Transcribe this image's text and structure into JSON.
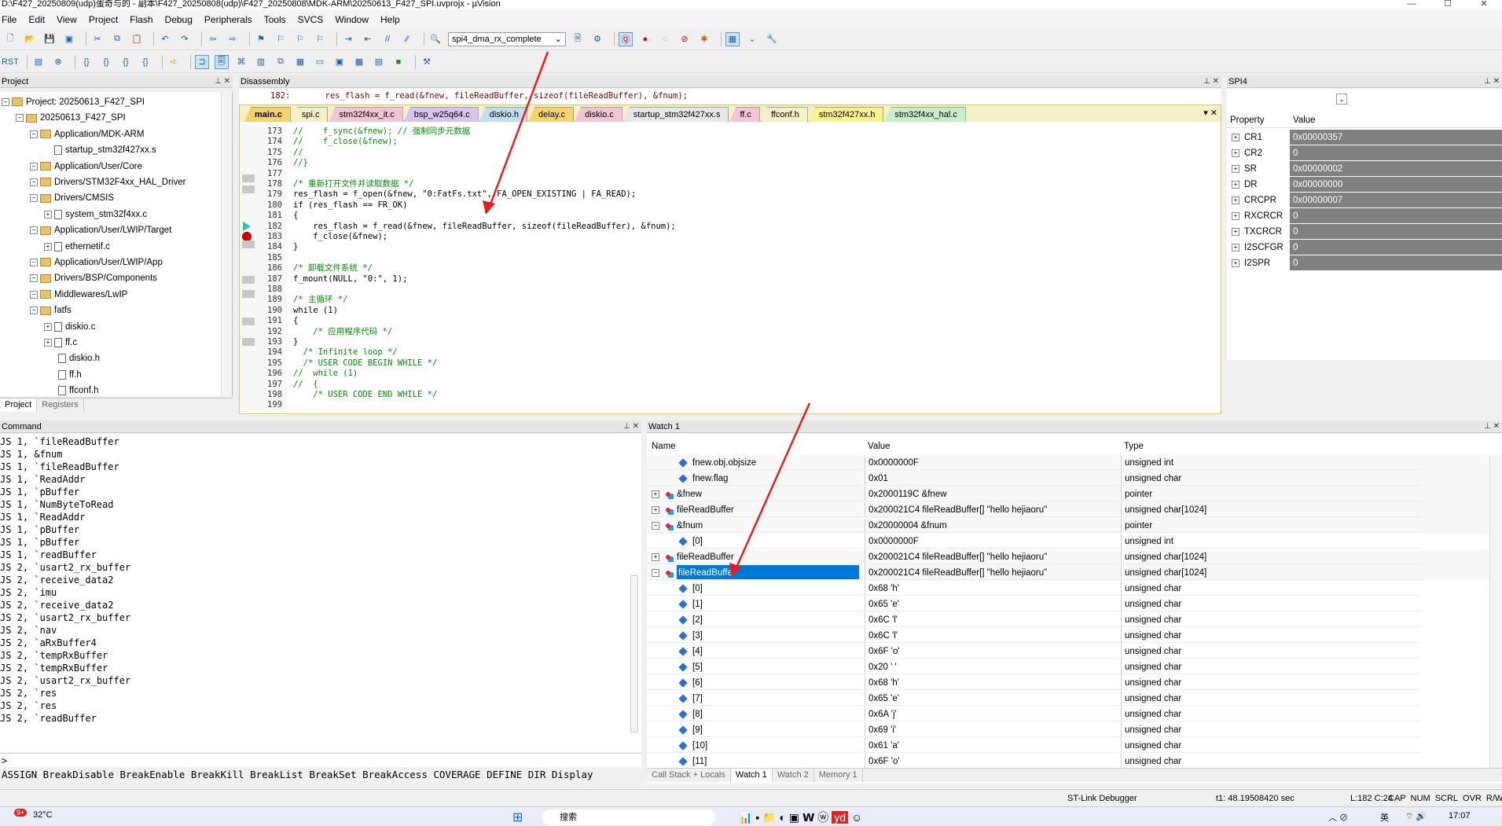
{
  "window": {
    "title": "D:\\F427_20250809(udp)蛋奇与的 - 副本\\F427_20250808(udp)\\F427_20250808\\MDK-ARM\\20250613_F427_SPI.uvprojx - µVision"
  },
  "menu": [
    "File",
    "Edit",
    "View",
    "Project",
    "Flash",
    "Debug",
    "Peripherals",
    "Tools",
    "SVCS",
    "Window",
    "Help"
  ],
  "toolbar": {
    "target": "spi4_dma_rx_complete"
  },
  "project": {
    "header": "Project",
    "items": [
      {
        "text": "Project: 20250613_F427_SPI",
        "indent": 0,
        "kind": "root"
      },
      {
        "text": "20250613_F427_SPI",
        "indent": 1,
        "kind": "folder"
      },
      {
        "text": "Application/MDK-ARM",
        "indent": 2,
        "kind": "folder"
      },
      {
        "text": "startup_stm32f427xx.s",
        "indent": 3,
        "kind": "file"
      },
      {
        "text": "Application/User/Core",
        "indent": 2,
        "kind": "folder"
      },
      {
        "text": "Drivers/STM32F4xx_HAL_Driver",
        "indent": 2,
        "kind": "folder"
      },
      {
        "text": "Drivers/CMSIS",
        "indent": 2,
        "kind": "folder"
      },
      {
        "text": "system_stm32f4xx.c",
        "indent": 3,
        "kind": "file"
      },
      {
        "text": "Application/User/LWIP/Target",
        "indent": 2,
        "kind": "folder"
      },
      {
        "text": "ethernetif.c",
        "indent": 3,
        "kind": "file"
      },
      {
        "text": "Application/User/LWIP/App",
        "indent": 2,
        "kind": "folder"
      },
      {
        "text": "Drivers/BSP/Components",
        "indent": 2,
        "kind": "folder"
      },
      {
        "text": "Middlewares/LwIP",
        "indent": 2,
        "kind": "folder"
      },
      {
        "text": "fatfs",
        "indent": 2,
        "kind": "folder"
      },
      {
        "text": "diskio.c",
        "indent": 3,
        "kind": "file"
      },
      {
        "text": "ff.c",
        "indent": 3,
        "kind": "file"
      },
      {
        "text": "diskio.h",
        "indent": 4,
        "kind": "file"
      },
      {
        "text": "ff.h",
        "indent": 4,
        "kind": "file"
      },
      {
        "text": "ffconf.h",
        "indent": 4,
        "kind": "file"
      }
    ],
    "tabs": [
      "Project",
      "Registers"
    ]
  },
  "disassembly": {
    "header": "Disassembly",
    "line": "182:       res_flash = f_read(&fnew, fileReadBuffer, sizeof(fileReadBuffer), &fnum);"
  },
  "editor": {
    "tabs": [
      {
        "label": "main.c",
        "color": "#f7d469"
      },
      {
        "label": "spi.c",
        "color": "#f4f0c8"
      },
      {
        "label": "stm32f4xx_it.c",
        "color": "#f3c6d6"
      },
      {
        "label": "bsp_w25q64.c",
        "color": "#d9c3f0"
      },
      {
        "label": "diskio.h",
        "color": "#bfe0f0"
      },
      {
        "label": "delay.c",
        "color": "#f7d469"
      },
      {
        "label": "diskio.c",
        "color": "#f3c6d6"
      },
      {
        "label": "startup_stm32f427xx.s",
        "color": "#e8e8e8"
      },
      {
        "label": "ff.c",
        "color": "#f3c6d6"
      },
      {
        "label": "ffconf.h",
        "color": "#f4f0c8"
      },
      {
        "label": "stm32f427xx.h",
        "color": "#f9f58a"
      },
      {
        "label": "stm32f4xx_hal.c",
        "color": "#c8f0c8"
      }
    ],
    "lines": [
      {
        "n": "173",
        "t": "//    f_sync(&fnew); // 强制同步元数据",
        "c": "cmt"
      },
      {
        "n": "174",
        "t": "//    f_close(&fnew);",
        "c": "cmt"
      },
      {
        "n": "175",
        "t": "//",
        "c": "cmt"
      },
      {
        "n": "176",
        "t": "//}",
        "c": "cmt"
      },
      {
        "n": "177",
        "t": "",
        "c": ""
      },
      {
        "n": "178",
        "t": "/* 重新打开文件并读取数据 */",
        "c": "cmt"
      },
      {
        "n": "179",
        "t": "res_flash = f_open(&fnew, \"0:FatFs.txt\", FA_OPEN_EXISTING | FA_READ);",
        "c": "mix179"
      },
      {
        "n": "180",
        "t": "if (res_flash == FR_OK)",
        "c": "kwif"
      },
      {
        "n": "181",
        "t": "{",
        "c": ""
      },
      {
        "n": "182",
        "t": "    res_flash = f_read(&fnew, fileReadBuffer, sizeof(fileReadBuffer), &fnum);",
        "c": "mix182"
      },
      {
        "n": "183",
        "t": "    f_close(&fnew);",
        "c": ""
      },
      {
        "n": "184",
        "t": "}",
        "c": ""
      },
      {
        "n": "185",
        "t": "",
        "c": ""
      },
      {
        "n": "186",
        "t": "/* 卸载文件系统 */",
        "c": "cmt"
      },
      {
        "n": "187",
        "t": "f_mount(NULL, \"0:\", 1);",
        "c": "mix187"
      },
      {
        "n": "188",
        "t": "",
        "c": ""
      },
      {
        "n": "189",
        "t": "/* 主循环 */",
        "c": "cmt"
      },
      {
        "n": "190",
        "t": "while (1)",
        "c": "kwwhile"
      },
      {
        "n": "191",
        "t": "{",
        "c": ""
      },
      {
        "n": "192",
        "t": "    /* 应用程序代码 */",
        "c": "cmt"
      },
      {
        "n": "193",
        "t": "}",
        "c": ""
      },
      {
        "n": "194",
        "t": "  /* Infinite loop */",
        "c": "cmt"
      },
      {
        "n": "195",
        "t": "  /* USER CODE BEGIN WHILE */",
        "c": "cmt"
      },
      {
        "n": "196",
        "t": "//  while (1)",
        "c": "cmt"
      },
      {
        "n": "197",
        "t": "//  {",
        "c": "cmt"
      },
      {
        "n": "198",
        "t": "    /* USER CODE END WHILE */",
        "c": "cmt"
      },
      {
        "n": "199",
        "t": "",
        "c": ""
      }
    ]
  },
  "spi4": {
    "header": "SPI4",
    "col_property": "Property",
    "col_value": "Value",
    "rows": [
      {
        "name": "CR1",
        "value": "0x00000357"
      },
      {
        "name": "CR2",
        "value": "0"
      },
      {
        "name": "SR",
        "value": "0x00000002"
      },
      {
        "name": "DR",
        "value": "0x00000000"
      },
      {
        "name": "CRCPR",
        "value": "0x00000007"
      },
      {
        "name": "RXCRCR",
        "value": "0"
      },
      {
        "name": "TXCRCR",
        "value": "0"
      },
      {
        "name": "I2SCFGR",
        "value": "0"
      },
      {
        "name": "I2SPR",
        "value": "0"
      }
    ]
  },
  "command": {
    "header": "Command",
    "lines": [
      "JS 1, `fileReadBuffer",
      "JS 1, &fnum",
      "JS 1, `fileReadBuffer",
      "JS 1, `ReadAddr",
      "JS 1, `pBuffer",
      "JS 1, `NumByteToRead",
      "JS 1, `ReadAddr",
      "JS 1, `pBuffer",
      "JS 1, `pBuffer",
      "JS 1, `readBuffer",
      "JS 2, `usart2_rx_buffer",
      "JS 2, `receive_data2",
      "JS 2, `imu",
      "JS 2, `receive_data2",
      "JS 2, `usart2_rx_buffer",
      "JS 2, `nav",
      "JS 2, `aRxBuffer4",
      "JS 2, `tempRxBuffer",
      "JS 2, `tempRxBuffer",
      "JS 2, `usart2_rx_buffer",
      "JS 2, `res",
      "JS 2, `res",
      "JS 2, `readBuffer"
    ],
    "prompt": ">",
    "help": "ASSIGN BreakDisable BreakEnable BreakKill BreakList BreakSet BreakAccess COVERAGE DEFINE DIR Display"
  },
  "watch": {
    "header": "Watch 1",
    "col_name": "Name",
    "col_value": "Value",
    "col_type": "Type",
    "rows": [
      {
        "name": "fnew.obj.objsize",
        "value": "0x0000000F",
        "type": "unsigned int",
        "indent": 1,
        "icon": "dia",
        "exp": ""
      },
      {
        "name": "fnew.flag",
        "value": "0x01",
        "type": "unsigned char",
        "indent": 1,
        "icon": "dia",
        "exp": ""
      },
      {
        "name": "&fnew",
        "value": "0x2000119C &fnew",
        "type": "pointer",
        "indent": 0,
        "icon": "strc",
        "exp": "+"
      },
      {
        "name": "fileReadBuffer",
        "value": "0x200021C4 fileReadBuffer[] \"hello hejiaoru\"",
        "type": "unsigned char[1024]",
        "indent": 0,
        "icon": "strc",
        "exp": "+"
      },
      {
        "name": "&fnum",
        "value": "0x20000004 &fnum",
        "type": "pointer",
        "indent": 0,
        "icon": "strc",
        "exp": "−"
      },
      {
        "name": "[0]",
        "value": "0x0000000F",
        "type": "unsigned int",
        "indent": 1,
        "icon": "dia",
        "exp": ""
      },
      {
        "name": "fileReadBuffer",
        "value": "0x200021C4 fileReadBuffer[] \"hello hejiaoru\"",
        "type": "unsigned char[1024]",
        "indent": 0,
        "icon": "strc",
        "exp": "+"
      },
      {
        "name": "fileReadBuffer",
        "value": "0x200021C4 fileReadBuffer[] \"hello hejiaoru\"",
        "type": "unsigned char[1024]",
        "indent": 0,
        "icon": "strc",
        "exp": "−",
        "sel": true
      },
      {
        "name": "[0]",
        "value": "0x68 'h'",
        "type": "unsigned char",
        "indent": 1,
        "icon": "dia",
        "exp": ""
      },
      {
        "name": "[1]",
        "value": "0x65 'e'",
        "type": "unsigned char",
        "indent": 1,
        "icon": "dia",
        "exp": ""
      },
      {
        "name": "[2]",
        "value": "0x6C 'l'",
        "type": "unsigned char",
        "indent": 1,
        "icon": "dia",
        "exp": ""
      },
      {
        "name": "[3]",
        "value": "0x6C 'l'",
        "type": "unsigned char",
        "indent": 1,
        "icon": "dia",
        "exp": ""
      },
      {
        "name": "[4]",
        "value": "0x6F 'o'",
        "type": "unsigned char",
        "indent": 1,
        "icon": "dia",
        "exp": ""
      },
      {
        "name": "[5]",
        "value": "0x20 ' '",
        "type": "unsigned char",
        "indent": 1,
        "icon": "dia",
        "exp": ""
      },
      {
        "name": "[6]",
        "value": "0x68 'h'",
        "type": "unsigned char",
        "indent": 1,
        "icon": "dia",
        "exp": ""
      },
      {
        "name": "[7]",
        "value": "0x65 'e'",
        "type": "unsigned char",
        "indent": 1,
        "icon": "dia",
        "exp": ""
      },
      {
        "name": "[8]",
        "value": "0x6A 'j'",
        "type": "unsigned char",
        "indent": 1,
        "icon": "dia",
        "exp": ""
      },
      {
        "name": "[9]",
        "value": "0x69 'i'",
        "type": "unsigned char",
        "indent": 1,
        "icon": "dia",
        "exp": ""
      },
      {
        "name": "[10]",
        "value": "0x61 'a'",
        "type": "unsigned char",
        "indent": 1,
        "icon": "dia",
        "exp": ""
      },
      {
        "name": "[11]",
        "value": "0x6F 'o'",
        "type": "unsigned char",
        "indent": 1,
        "icon": "dia",
        "exp": ""
      }
    ],
    "tabs": [
      "Call Stack + Locals",
      "Watch 1",
      "Watch 2",
      "Memory 1"
    ]
  },
  "status": {
    "debugger": "ST-Link Debugger",
    "time": "t1: 48.19508420 sec",
    "pos": "L:182 C:24",
    "flags": [
      "CAP",
      "NUM",
      "SCRL",
      "OVR",
      "R/W"
    ]
  },
  "taskbar": {
    "badge": "9+",
    "temp": "32°C",
    "search": "搜索",
    "ime": "英",
    "clock": "17:07"
  }
}
